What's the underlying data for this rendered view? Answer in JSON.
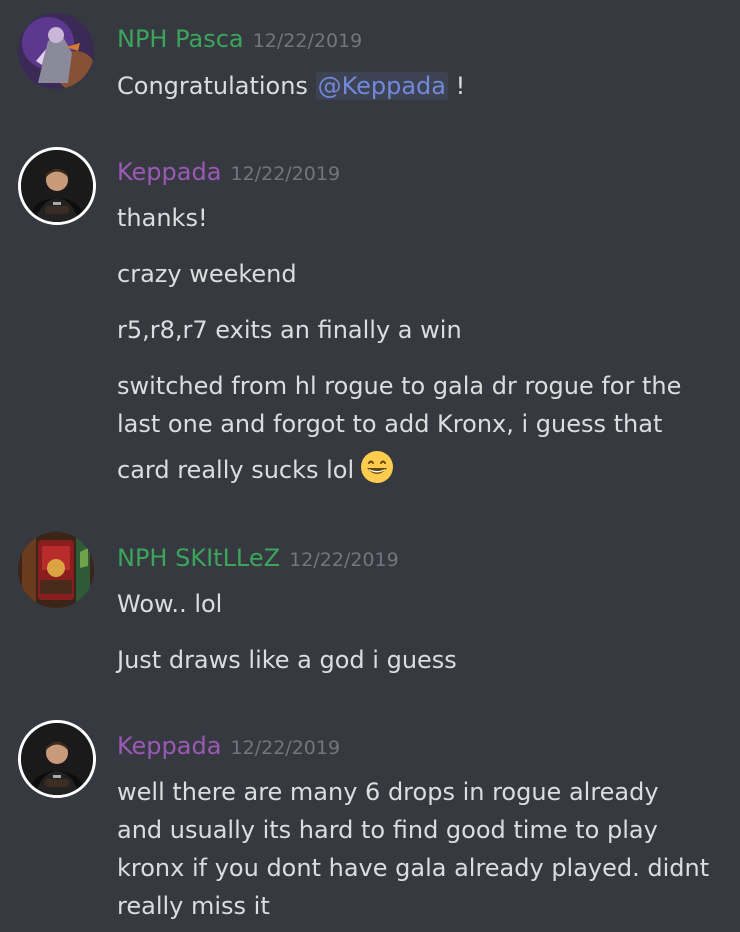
{
  "colors": {
    "background": "#36393f",
    "text": "#dcddde",
    "timestamp": "#72767d",
    "mod_green": "#3ba55c",
    "purple": "#9b59b6",
    "mention": "#7289da"
  },
  "messages": [
    {
      "author": "NPH Pasca",
      "author_color": "#3ba55c",
      "timestamp": "12/22/2019",
      "avatar": "pasca-avatar",
      "lines": [
        {
          "prefix": "Congratulations ",
          "mention": "@Keppada",
          "suffix": " !"
        }
      ]
    },
    {
      "author": "Keppada",
      "author_color": "#9b59b6",
      "timestamp": "12/22/2019",
      "avatar": "keppada-avatar",
      "lines": [
        {
          "text": "thanks!"
        },
        {
          "text": "crazy weekend"
        },
        {
          "text": "r5,r8,r7 exits an finally a win"
        },
        {
          "text": "switched from hl rogue to gala dr rogue for the"
        },
        {
          "text": "last one and forgot to add Kronx, i guess that"
        },
        {
          "text": "card really sucks lol",
          "emoji": "grinning-face-emoji"
        }
      ]
    },
    {
      "author": "NPH SKItLLeZ",
      "author_color": "#3ba55c",
      "timestamp": "12/22/2019",
      "avatar": "skittlez-avatar",
      "lines": [
        {
          "text": "Wow.. lol"
        },
        {
          "text": "Just draws like a god i guess"
        }
      ]
    },
    {
      "author": "Keppada",
      "author_color": "#9b59b6",
      "timestamp": "12/22/2019",
      "avatar": "keppada-avatar",
      "lines": [
        {
          "text": "well there are many 6 drops in rogue already"
        },
        {
          "text": "and usually its hard to find good time to play"
        },
        {
          "text": "kronx if you dont have gala already played. didnt"
        },
        {
          "text": "really miss it"
        }
      ]
    }
  ]
}
